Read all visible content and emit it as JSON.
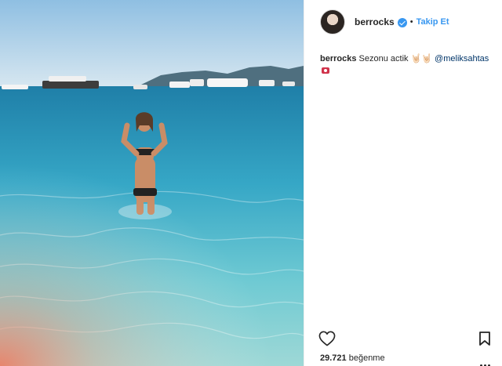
{
  "post": {
    "username": "berrocks",
    "separator": "•",
    "follow_label": "Takip Et",
    "caption": {
      "username": "berrocks",
      "text": "Sezonu actik 🤘🏻🤘🏻 ",
      "mention": "@meliksahtas"
    },
    "likes": {
      "count": "29.721",
      "label": "beğenme"
    }
  },
  "colors": {
    "accent": "#3897f0",
    "text": "#262626",
    "mention": "#003569",
    "divider": "#efefef"
  },
  "icons": {
    "verified": "verified-badge-icon",
    "camera": "camera-emoji-icon",
    "like": "heart-icon",
    "save": "bookmark-icon",
    "more": "more-options-icon"
  }
}
